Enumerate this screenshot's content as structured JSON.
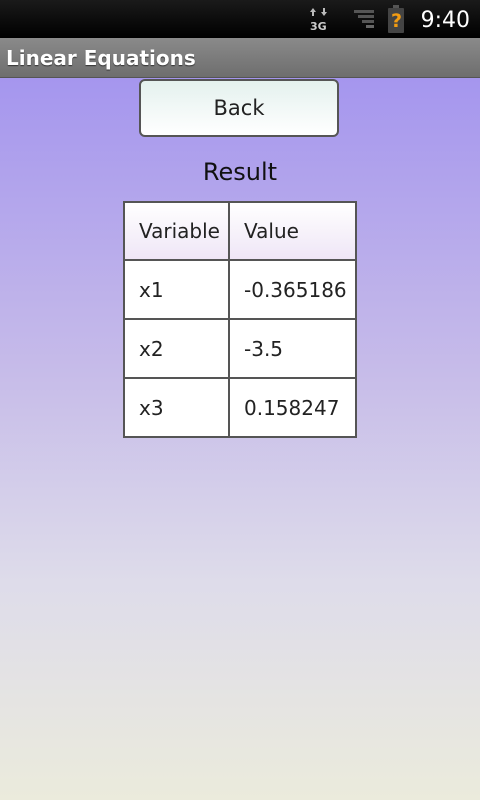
{
  "status_bar": {
    "time": "9:40",
    "icons": [
      "network-3g-icon",
      "signal-icon",
      "battery-unknown-icon"
    ]
  },
  "app": {
    "title": "Linear Equations"
  },
  "main": {
    "back_label": "Back",
    "result_heading": "Result",
    "table": {
      "headers": [
        "Variable",
        "Value"
      ],
      "rows": [
        {
          "variable": "x1",
          "value": "-0.365186"
        },
        {
          "variable": "x2",
          "value": "-3.5"
        },
        {
          "variable": "x3",
          "value": "0.158247"
        }
      ]
    }
  },
  "colors": {
    "gradient_top": "#a596ee",
    "gradient_bottom": "#ebebdc",
    "title_bar": "#7c7c7c"
  }
}
